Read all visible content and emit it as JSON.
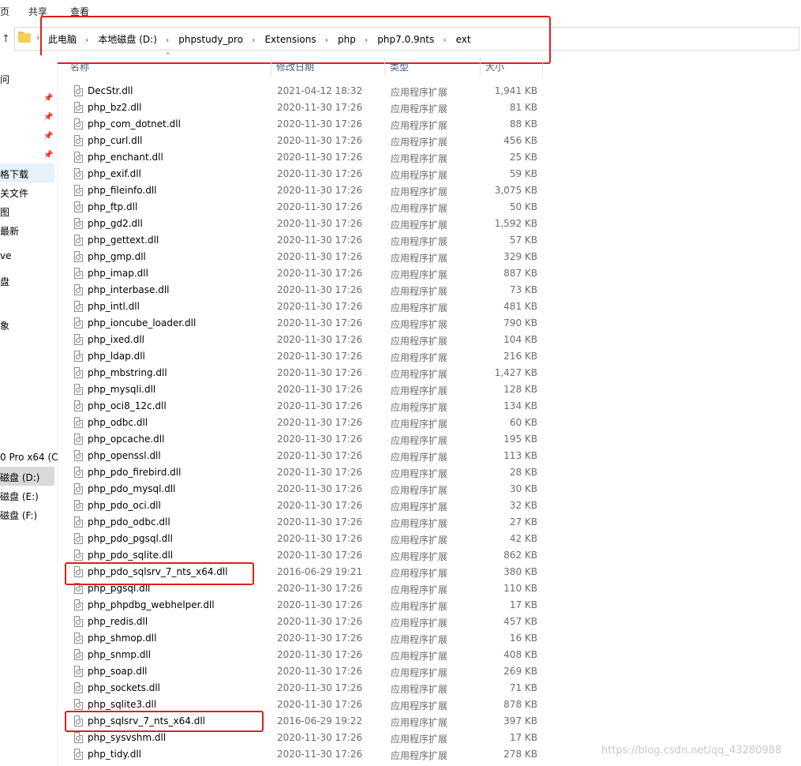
{
  "ribbon": {
    "tabs": [
      "页",
      "共享",
      "查看"
    ]
  },
  "address": {
    "crumbs": [
      "此电脑",
      "本地磁盘 (D:)",
      "phpstudy_pro",
      "Extensions",
      "php",
      "php7.0.9nts",
      "ext"
    ]
  },
  "sidebar": {
    "items": [
      "问",
      "格下载",
      "关文件",
      "图",
      "最新",
      "ve",
      "盘",
      "象",
      "0 Pro x64 (C",
      "磁盘 (D:)",
      "磁盘 (E:)",
      "磁盘 (F:)"
    ]
  },
  "columns": {
    "name": "名称",
    "date": "修改日期",
    "type": "类型",
    "size": "大小"
  },
  "files": [
    {
      "name": "DecStr.dll",
      "date": "2021-04-12 18:32",
      "type": "应用程序扩展",
      "size": "1,941 KB"
    },
    {
      "name": "php_bz2.dll",
      "date": "2020-11-30 17:26",
      "type": "应用程序扩展",
      "size": "81 KB"
    },
    {
      "name": "php_com_dotnet.dll",
      "date": "2020-11-30 17:26",
      "type": "应用程序扩展",
      "size": "88 KB"
    },
    {
      "name": "php_curl.dll",
      "date": "2020-11-30 17:26",
      "type": "应用程序扩展",
      "size": "456 KB"
    },
    {
      "name": "php_enchant.dll",
      "date": "2020-11-30 17:26",
      "type": "应用程序扩展",
      "size": "25 KB"
    },
    {
      "name": "php_exif.dll",
      "date": "2020-11-30 17:26",
      "type": "应用程序扩展",
      "size": "59 KB"
    },
    {
      "name": "php_fileinfo.dll",
      "date": "2020-11-30 17:26",
      "type": "应用程序扩展",
      "size": "3,075 KB"
    },
    {
      "name": "php_ftp.dll",
      "date": "2020-11-30 17:26",
      "type": "应用程序扩展",
      "size": "50 KB"
    },
    {
      "name": "php_gd2.dll",
      "date": "2020-11-30 17:26",
      "type": "应用程序扩展",
      "size": "1,592 KB"
    },
    {
      "name": "php_gettext.dll",
      "date": "2020-11-30 17:26",
      "type": "应用程序扩展",
      "size": "57 KB"
    },
    {
      "name": "php_gmp.dll",
      "date": "2020-11-30 17:26",
      "type": "应用程序扩展",
      "size": "329 KB"
    },
    {
      "name": "php_imap.dll",
      "date": "2020-11-30 17:26",
      "type": "应用程序扩展",
      "size": "887 KB"
    },
    {
      "name": "php_interbase.dll",
      "date": "2020-11-30 17:26",
      "type": "应用程序扩展",
      "size": "73 KB"
    },
    {
      "name": "php_intl.dll",
      "date": "2020-11-30 17:26",
      "type": "应用程序扩展",
      "size": "481 KB"
    },
    {
      "name": "php_ioncube_loader.dll",
      "date": "2020-11-30 17:26",
      "type": "应用程序扩展",
      "size": "790 KB"
    },
    {
      "name": "php_ixed.dll",
      "date": "2020-11-30 17:26",
      "type": "应用程序扩展",
      "size": "104 KB"
    },
    {
      "name": "php_ldap.dll",
      "date": "2020-11-30 17:26",
      "type": "应用程序扩展",
      "size": "216 KB"
    },
    {
      "name": "php_mbstring.dll",
      "date": "2020-11-30 17:26",
      "type": "应用程序扩展",
      "size": "1,427 KB"
    },
    {
      "name": "php_mysqli.dll",
      "date": "2020-11-30 17:26",
      "type": "应用程序扩展",
      "size": "128 KB"
    },
    {
      "name": "php_oci8_12c.dll",
      "date": "2020-11-30 17:26",
      "type": "应用程序扩展",
      "size": "134 KB"
    },
    {
      "name": "php_odbc.dll",
      "date": "2020-11-30 17:26",
      "type": "应用程序扩展",
      "size": "60 KB"
    },
    {
      "name": "php_opcache.dll",
      "date": "2020-11-30 17:26",
      "type": "应用程序扩展",
      "size": "195 KB"
    },
    {
      "name": "php_openssl.dll",
      "date": "2020-11-30 17:26",
      "type": "应用程序扩展",
      "size": "113 KB"
    },
    {
      "name": "php_pdo_firebird.dll",
      "date": "2020-11-30 17:26",
      "type": "应用程序扩展",
      "size": "28 KB"
    },
    {
      "name": "php_pdo_mysql.dll",
      "date": "2020-11-30 17:26",
      "type": "应用程序扩展",
      "size": "30 KB"
    },
    {
      "name": "php_pdo_oci.dll",
      "date": "2020-11-30 17:26",
      "type": "应用程序扩展",
      "size": "32 KB"
    },
    {
      "name": "php_pdo_odbc.dll",
      "date": "2020-11-30 17:26",
      "type": "应用程序扩展",
      "size": "27 KB"
    },
    {
      "name": "php_pdo_pgsql.dll",
      "date": "2020-11-30 17:26",
      "type": "应用程序扩展",
      "size": "42 KB"
    },
    {
      "name": "php_pdo_sqlite.dll",
      "date": "2020-11-30 17:26",
      "type": "应用程序扩展",
      "size": "862 KB"
    },
    {
      "name": "php_pdo_sqlsrv_7_nts_x64.dll",
      "date": "2016-06-29 19:21",
      "type": "应用程序扩展",
      "size": "380 KB",
      "highlighted": true
    },
    {
      "name": "php_pgsql.dll",
      "date": "2020-11-30 17:26",
      "type": "应用程序扩展",
      "size": "110 KB"
    },
    {
      "name": "php_phpdbg_webhelper.dll",
      "date": "2020-11-30 17:26",
      "type": "应用程序扩展",
      "size": "17 KB"
    },
    {
      "name": "php_redis.dll",
      "date": "2020-11-30 17:26",
      "type": "应用程序扩展",
      "size": "457 KB"
    },
    {
      "name": "php_shmop.dll",
      "date": "2020-11-30 17:26",
      "type": "应用程序扩展",
      "size": "16 KB"
    },
    {
      "name": "php_snmp.dll",
      "date": "2020-11-30 17:26",
      "type": "应用程序扩展",
      "size": "408 KB"
    },
    {
      "name": "php_soap.dll",
      "date": "2020-11-30 17:26",
      "type": "应用程序扩展",
      "size": "269 KB"
    },
    {
      "name": "php_sockets.dll",
      "date": "2020-11-30 17:26",
      "type": "应用程序扩展",
      "size": "71 KB"
    },
    {
      "name": "php_sqlite3.dll",
      "date": "2020-11-30 17:26",
      "type": "应用程序扩展",
      "size": "878 KB"
    },
    {
      "name": "php_sqlsrv_7_nts_x64.dll",
      "date": "2016-06-29 19:22",
      "type": "应用程序扩展",
      "size": "397 KB",
      "highlighted": true
    },
    {
      "name": "php_sysvshm.dll",
      "date": "2020-11-30 17:26",
      "type": "应用程序扩展",
      "size": "17 KB"
    },
    {
      "name": "php_tidy.dll",
      "date": "2020-11-30 17:26",
      "type": "应用程序扩展",
      "size": "278 KB"
    }
  ],
  "watermark": "https://blog.csdn.net/qq_43280988",
  "colors": {
    "highlight_box": "#e01e1e",
    "header_text": "#4c607a",
    "selected_drive": "#d9d9d9"
  }
}
